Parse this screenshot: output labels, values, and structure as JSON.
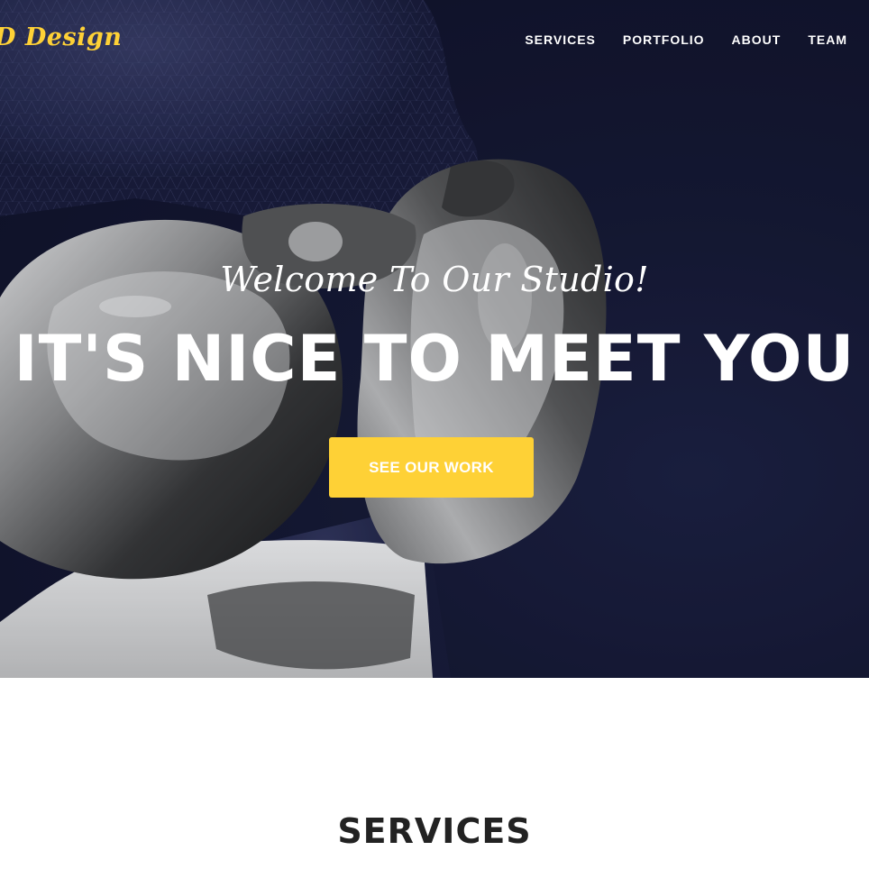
{
  "navbar": {
    "brand": "D Design",
    "links": [
      {
        "label": "SERVICES"
      },
      {
        "label": "PORTFOLIO"
      },
      {
        "label": "ABOUT"
      },
      {
        "label": "TEAM"
      }
    ]
  },
  "hero": {
    "lead_in": "Welcome To Our Studio!",
    "heading": "IT'S NICE TO MEET YOU",
    "button_label": "SEE OUR WORK",
    "background_image": "3d-robot-sculpture-image"
  },
  "services": {
    "heading": "SERVICES"
  },
  "colors": {
    "accent": "#fed136",
    "hero_background": "#161935",
    "heading_dark": "#222222",
    "text_light": "#ffffff"
  }
}
